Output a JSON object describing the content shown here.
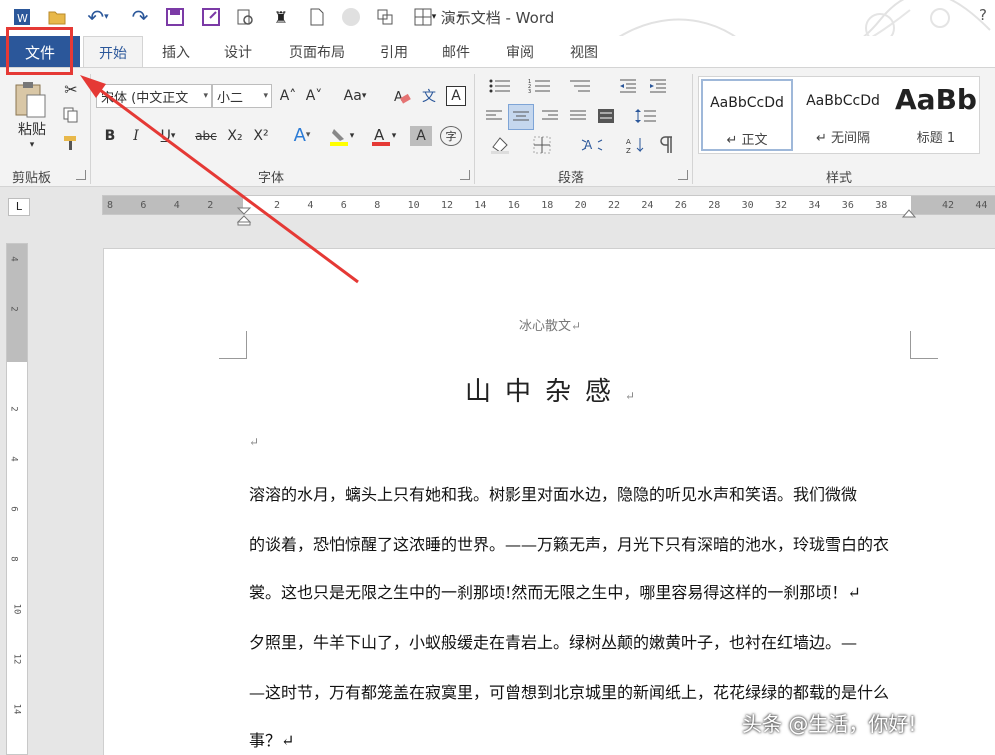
{
  "title_bar": {
    "title": "演示文档 - Word",
    "help": "?",
    "quick_access": [
      {
        "name": "word-logo-icon",
        "glyph": "W"
      },
      {
        "name": "open-folder-icon",
        "glyph": "📂"
      },
      {
        "name": "undo-icon",
        "glyph": "↶"
      },
      {
        "name": "redo-icon",
        "glyph": "↷"
      },
      {
        "name": "save-icon",
        "glyph": "💾"
      },
      {
        "name": "save-as-icon",
        "glyph": "🖫"
      },
      {
        "name": "print-preview-icon",
        "glyph": "⎙"
      },
      {
        "name": "format-painter-qa-icon",
        "glyph": "♜"
      },
      {
        "name": "new-doc-icon",
        "glyph": "🗋"
      },
      {
        "name": "circle-icon",
        "glyph": "●"
      },
      {
        "name": "screenshot-icon",
        "glyph": "⧉"
      },
      {
        "name": "table-icon",
        "glyph": "⊞"
      },
      {
        "name": "customize-icon",
        "glyph": "▾"
      }
    ]
  },
  "tabs": {
    "file": "文件",
    "items": [
      "开始",
      "插入",
      "设计",
      "页面布局",
      "引用",
      "邮件",
      "审阅",
      "视图"
    ],
    "active": "开始"
  },
  "ribbon": {
    "clipboard": {
      "label": "剪贴板",
      "paste": "粘贴"
    },
    "font": {
      "label": "字体",
      "font_name": "宋体 (中文正文",
      "font_size": "小二",
      "buttons": [
        "B",
        "I",
        "U",
        "abc",
        "X₂",
        "X²"
      ],
      "grow": "A˄",
      "shrink": "A˅",
      "case": "Aa",
      "clear": "A",
      "phonetic": "文",
      "border": "A",
      "text_effect": "A",
      "highlight": "ab",
      "font_color": "A",
      "shading": "A",
      "enclose": "字"
    },
    "paragraph": {
      "label": "段落"
    },
    "styles": {
      "label": "样式",
      "items": [
        {
          "sample": "AaBbCcDd",
          "name": "↵ 正文"
        },
        {
          "sample": "AaBbCcDd",
          "name": "↵ 无间隔"
        },
        {
          "sample": "AaBb",
          "name": "标题 1"
        }
      ]
    }
  },
  "ruler": {
    "selector": "L",
    "ticks": [
      "8",
      "6",
      "4",
      "2",
      "",
      "2",
      "4",
      "6",
      "8",
      "10",
      "12",
      "14",
      "16",
      "18",
      "20",
      "22",
      "24",
      "26",
      "28",
      "30",
      "32",
      "34",
      "36",
      "38",
      "",
      "42",
      "44"
    ],
    "vticks": [
      "4",
      "2",
      "",
      "2",
      "4",
      "6",
      "8",
      "10",
      "12",
      "14"
    ]
  },
  "document": {
    "header": "冰心散文",
    "title": "山中杂感",
    "lines": [
      "↵",
      "    溶溶的水月，螭头上只有她和我。树影里对面水边，隐隐的听见水声和笑语。我们微微",
      "的谈着，恐怕惊醒了这浓睡的世界。——万籁无声，月光下只有深暗的池水，玲珑雪白的衣",
      "裳。这也只是无限之生中的一刹那顷!然而无限之生中，哪里容易得这样的一刹那顷！↵",
      "    夕照里，牛羊下山了，小蚁般缓走在青岩上。绿树丛颠的嫩黄叶子，也衬在红墙边。—",
      "—这时节，万有都笼盖在寂寞里，可曾想到北京城里的新闻纸上，花花绿绿的都载的是什么",
      "事？↵"
    ]
  },
  "watermark": "头条 @生活，你好!",
  "colors": {
    "accent": "#2b579a",
    "highlight_red": "#e53935",
    "highlight_yellow": "#ffff00"
  }
}
